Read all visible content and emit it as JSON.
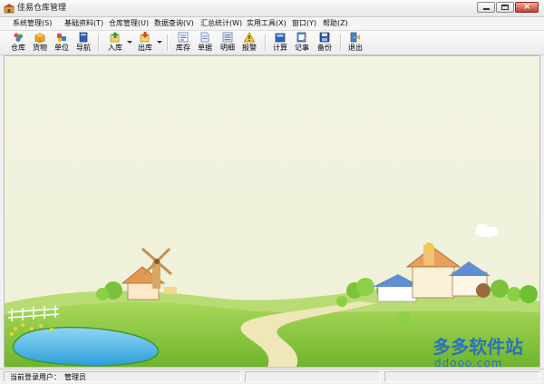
{
  "window": {
    "title": "佳易仓库管理",
    "controls": {
      "minimize": "minimize-icon",
      "maximize": "maximize-icon",
      "close": "close-icon"
    }
  },
  "menu": [
    "系统管理(S)",
    "基础资料(T)",
    "仓库管理(U)",
    "数据查询(V)",
    "汇总统计(W)",
    "实用工具(X)",
    "窗口(Y)",
    "帮助(Z)"
  ],
  "toolbar": [
    {
      "label": "仓库",
      "icon": "warehouse-icon"
    },
    {
      "label": "货物",
      "icon": "goods-box-icon"
    },
    {
      "label": "单位",
      "icon": "unit-icon"
    },
    {
      "label": "导航",
      "icon": "navigation-book-icon"
    },
    {
      "label": "入库",
      "icon": "stock-in-icon",
      "dropdown": true
    },
    {
      "label": "出库",
      "icon": "stock-out-icon",
      "dropdown": true
    },
    {
      "label": "库存",
      "icon": "inventory-icon"
    },
    {
      "label": "单据",
      "icon": "document-icon"
    },
    {
      "label": "明细",
      "icon": "detail-list-icon"
    },
    {
      "label": "报警",
      "icon": "alarm-warning-icon"
    },
    {
      "label": "计算",
      "icon": "calculator-icon"
    },
    {
      "label": "记事",
      "icon": "notes-icon"
    },
    {
      "label": "备份",
      "icon": "backup-disk-icon"
    },
    {
      "label": "退出",
      "icon": "exit-door-icon"
    }
  ],
  "watermark": {
    "text": "多多软件站",
    "url": "ddooo.com"
  },
  "status": {
    "label": "当前登录用户：",
    "user": "管理员"
  },
  "colors": {
    "sky": "#f1f1de",
    "grass": "#7fc33a",
    "path": "#e9e1ad",
    "pond": "#4ab7e8",
    "brand": "#2b72b9"
  }
}
